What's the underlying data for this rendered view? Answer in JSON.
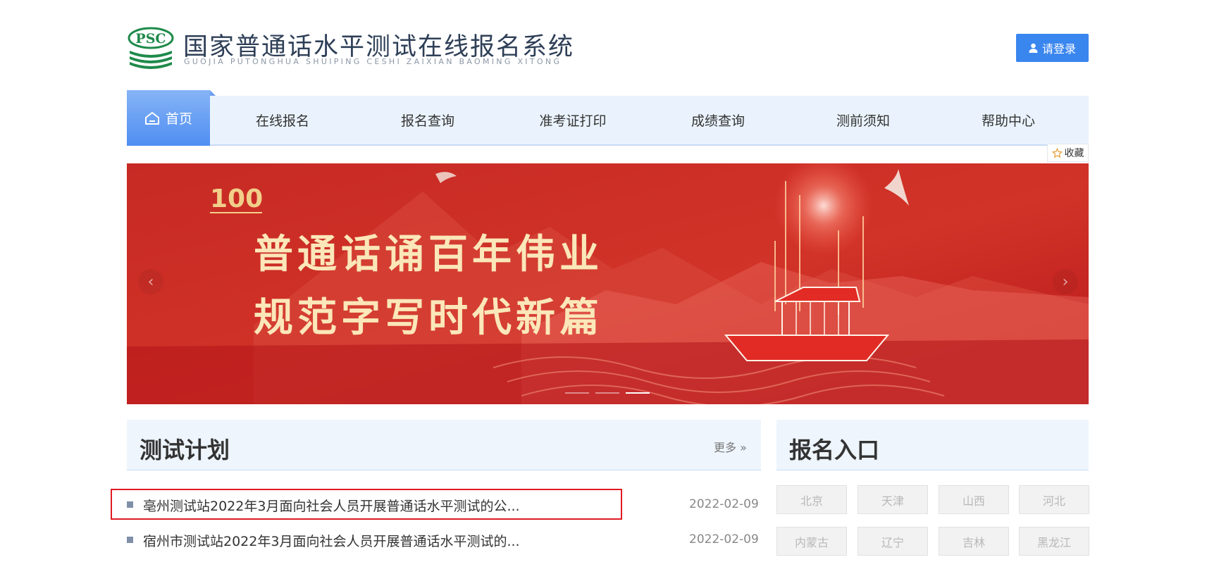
{
  "header": {
    "logo_text": "PSC",
    "title": "国家普通话水平测试在线报名系统",
    "subtitle": "GUOJIA PUTONGHUA SHUIPING CESHI ZAIXIAN BAOMING XITONG",
    "login_label": "请登录"
  },
  "nav": {
    "home": "首页",
    "items": [
      "在线报名",
      "报名查询",
      "准考证打印",
      "成绩查询",
      "测前须知",
      "帮助中心"
    ]
  },
  "favorite_label": "收藏",
  "banner": {
    "line1": "普通话诵百年伟业",
    "line2": "规范字写时代新篇",
    "slide_count": 3,
    "active_slide": 3
  },
  "plan": {
    "title": "测试计划",
    "more_label": "更多",
    "items": [
      {
        "title": "亳州测试站2022年3月面向社会人员开展普通话水平测试的公...",
        "date": "2022-02-09"
      },
      {
        "title": "宿州市测试站2022年3月面向社会人员开展普通话水平测试的...",
        "date": "2022-02-09"
      }
    ]
  },
  "entry": {
    "title": "报名入口",
    "provinces": [
      "北京",
      "天津",
      "山西",
      "河北",
      "内蒙古",
      "辽宁",
      "吉林",
      "黑龙江"
    ]
  },
  "colors": {
    "primary": "#3a86ef",
    "nav_bg": "#eaf3fd",
    "banner_red": "#c9231f",
    "highlight": "#e01b24",
    "logo_green": "#1e8a4a"
  }
}
